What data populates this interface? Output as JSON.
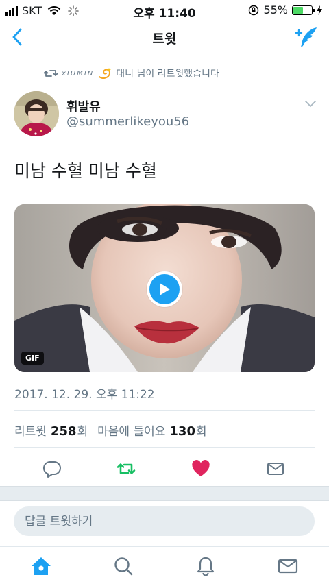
{
  "status_bar": {
    "carrier": "SKT",
    "time": "오후 11:40",
    "battery_percent": "55%",
    "battery_level": 0.55
  },
  "nav": {
    "title": "트윗",
    "back_icon": "chevron-left-icon",
    "compose_icon": "compose-tweet-icon"
  },
  "retweet_context": {
    "icon": "retweet-icon",
    "latin_name": "xIUMIN",
    "text": "대니 님이 리트윗했습니다"
  },
  "tweet": {
    "author_name": "휘발유",
    "author_handle": "@summerlikeyou56",
    "text": "미남 수혈 미남 수혈",
    "media_badge": "GIF",
    "timestamp": "2017. 12. 29. 오후 11:22",
    "retweet_label": "리트윗",
    "retweet_count": "258",
    "retweet_unit": "회",
    "like_label": "마음에 들어요",
    "like_count": "130",
    "like_unit": "회"
  },
  "actions": [
    "reply-icon",
    "retweet-icon",
    "heart-icon",
    "direct-message-icon"
  ],
  "colors": {
    "accent": "#1da1f2",
    "retweet_green": "#17bf63",
    "like_red": "#e0245e",
    "muted": "#657786"
  },
  "reply": {
    "placeholder": "답글 트윗하기"
  },
  "tab_bar": [
    "home-icon",
    "search-icon",
    "notifications-icon",
    "messages-icon"
  ]
}
